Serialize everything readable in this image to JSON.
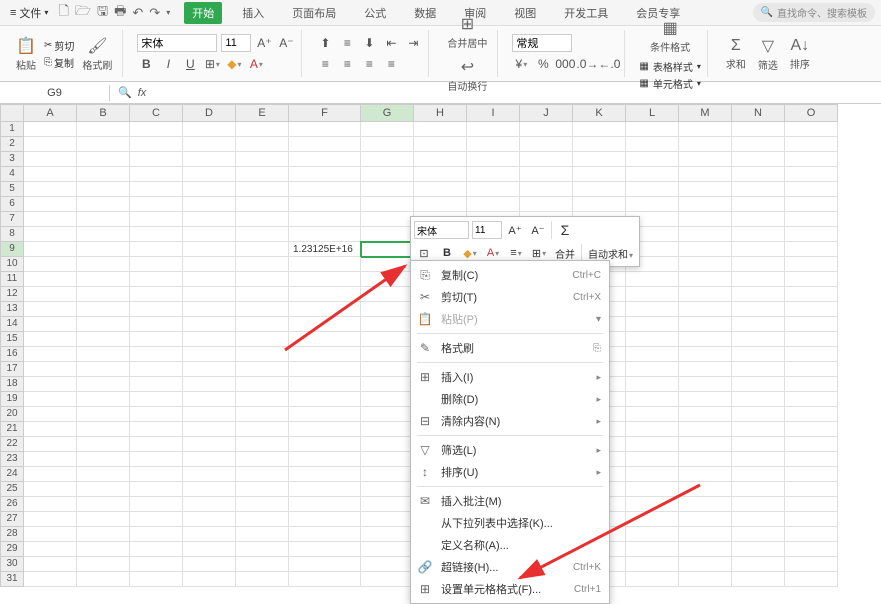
{
  "menubar": {
    "file_label": "文件",
    "tabs": [
      "开始",
      "插入",
      "页面布局",
      "公式",
      "数据",
      "审阅",
      "视图",
      "开发工具",
      "会员专享"
    ],
    "active_tab": 0,
    "search_placeholder": "直找命令、搜索模板"
  },
  "ribbon": {
    "paste": "粘贴",
    "cut": "剪切",
    "copy": "复制",
    "format_painter": "格式刷",
    "font_name": "宋体",
    "font_size": "11",
    "merge_center": "合并居中",
    "wrap_text": "自动换行",
    "number_format": "常规",
    "cond_format": "条件格式",
    "table_style": "表格样式",
    "cell_format": "单元格式",
    "sum": "求和",
    "filter": "筛选",
    "sort": "排序"
  },
  "formula_bar": {
    "name_box": "G9",
    "fx": "fx"
  },
  "columns": [
    "A",
    "B",
    "C",
    "D",
    "E",
    "F",
    "G",
    "H",
    "I",
    "J",
    "K",
    "L",
    "M",
    "N",
    "O"
  ],
  "row_count": 31,
  "selected_col": "G",
  "selected_row": 9,
  "cells": {
    "F9": "1.23125E+16"
  },
  "mini_toolbar": {
    "font_name": "宋体",
    "font_size": "11",
    "merge": "合并",
    "autosum": "自动求和"
  },
  "context_menu": {
    "items": [
      {
        "icon": "⎘",
        "label": "复制(C)",
        "shortcut": "Ctrl+C",
        "enabled": true
      },
      {
        "icon": "✂",
        "label": "剪切(T)",
        "shortcut": "Ctrl+X",
        "enabled": true
      },
      {
        "icon": "📋",
        "label": "粘贴(P)",
        "shortcut": "",
        "enabled": false,
        "extra_icon": "▾"
      },
      {
        "sep": true
      },
      {
        "icon": "✎",
        "label": "格式刷",
        "shortcut": "",
        "enabled": true,
        "extra_icon": "⎘"
      },
      {
        "sep": true
      },
      {
        "icon": "⊞",
        "label": "插入(I)",
        "shortcut": "",
        "enabled": true,
        "arrow": true
      },
      {
        "icon": "",
        "label": "删除(D)",
        "shortcut": "",
        "enabled": true,
        "arrow": true
      },
      {
        "icon": "⊟",
        "label": "清除内容(N)",
        "shortcut": "",
        "enabled": true,
        "arrow": true
      },
      {
        "sep": true
      },
      {
        "icon": "▽",
        "label": "筛选(L)",
        "shortcut": "",
        "enabled": true,
        "arrow": true
      },
      {
        "icon": "↕",
        "label": "排序(U)",
        "shortcut": "",
        "enabled": true,
        "arrow": true
      },
      {
        "sep": true
      },
      {
        "icon": "✉",
        "label": "插入批注(M)",
        "shortcut": "",
        "enabled": true
      },
      {
        "icon": "",
        "label": "从下拉列表中选择(K)...",
        "shortcut": "",
        "enabled": true
      },
      {
        "icon": "",
        "label": "定义名称(A)...",
        "shortcut": "",
        "enabled": true
      },
      {
        "icon": "🔗",
        "label": "超链接(H)...",
        "shortcut": "Ctrl+K",
        "enabled": true
      },
      {
        "icon": "⊞",
        "label": "设置单元格格式(F)...",
        "shortcut": "Ctrl+1",
        "enabled": true
      }
    ]
  }
}
